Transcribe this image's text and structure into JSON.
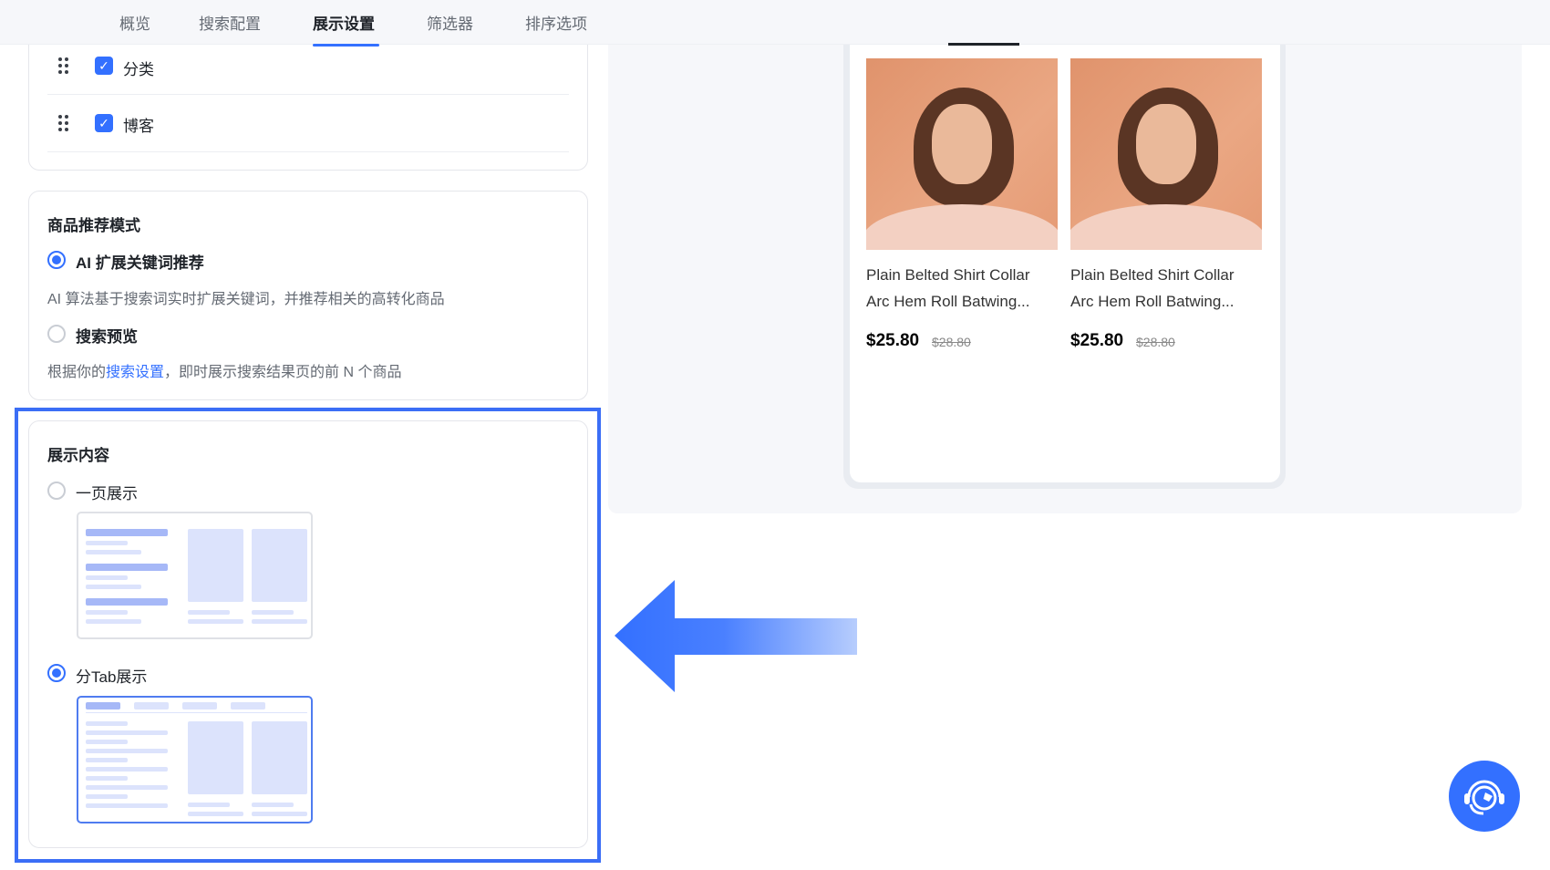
{
  "nav": {
    "tabs": [
      "概览",
      "搜索配置",
      "展示设置",
      "筛选器",
      "排序选项"
    ],
    "active": "展示设置"
  },
  "content_types": [
    {
      "label": "分类",
      "checked": true
    },
    {
      "label": "博客",
      "checked": true
    }
  ],
  "recommend": {
    "title": "商品推荐模式",
    "options": [
      {
        "label": "AI 扩展关键词推荐",
        "selected": true,
        "desc": "AI 算法基于搜索词实时扩展关键词，并推荐相关的高转化商品"
      },
      {
        "label": "搜索预览",
        "selected": false,
        "desc_prefix": "根据你的",
        "desc_link": "搜索设置",
        "desc_suffix": "，即时展示搜索结果页的前 N 个商品"
      }
    ]
  },
  "display": {
    "title": "展示内容",
    "options": [
      {
        "label": "一页展示",
        "selected": false
      },
      {
        "label": "分Tab展示",
        "selected": true
      }
    ]
  },
  "preview": {
    "products": [
      {
        "title_line1": "Plain Belted Shirt Collar",
        "title_line2": "Arc Hem Roll Batwing...",
        "price": "$25.80",
        "original_price": "$28.80"
      },
      {
        "title_line1": "Plain Belted Shirt Collar",
        "title_line2": "Arc Hem Roll Batwing...",
        "price": "$25.80",
        "original_price": "$28.80"
      }
    ]
  },
  "colors": {
    "accent": "#3370ff",
    "highlight": "#3b6ef6"
  }
}
